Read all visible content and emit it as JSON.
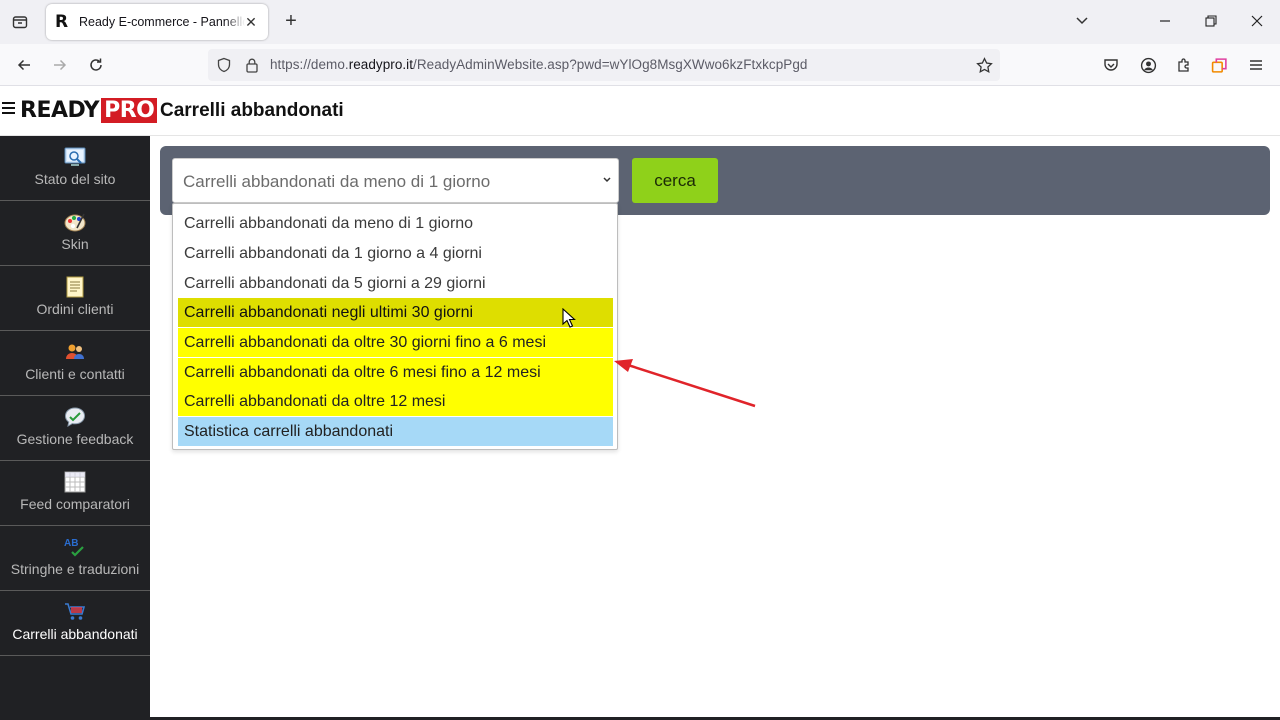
{
  "browser": {
    "tab_title": "Ready E-commerce - Pannello di controllo",
    "favicon_letter": "R",
    "url_prefix": "https://demo.",
    "url_domain": "readypro.it",
    "url_path": "/ReadyAdminWebsite.asp?pwd=wYlOg8MsgXWwo6kzFtxkcpPgd"
  },
  "header": {
    "logo_ready": "READY",
    "logo_pro": "PRO",
    "page_title": "Carrelli abbandonati"
  },
  "sidebar": {
    "items": [
      {
        "label": "Stato del sito",
        "icon": "monitor-icon"
      },
      {
        "label": "Skin",
        "icon": "palette-icon"
      },
      {
        "label": "Ordini clienti",
        "icon": "notepad-icon"
      },
      {
        "label": "Clienti e contatti",
        "icon": "users-icon"
      },
      {
        "label": "Gestione feedback",
        "icon": "feedback-bubble-icon"
      },
      {
        "label": "Feed comparatori",
        "icon": "grid-icon"
      },
      {
        "label": "Stringhe e traduzioni",
        "icon": "spellcheck-icon"
      },
      {
        "label": "Carrelli abbandonati",
        "icon": "cart-icon"
      }
    ],
    "active_index": 7
  },
  "search": {
    "selected_value": "Carrelli abbandonati da meno di 1 giorno",
    "button_label": "cerca",
    "options": [
      "Carrelli abbandonati da meno di 1 giorno",
      "Carrelli abbandonati da 1 giorno a 4 giorni",
      "Carrelli abbandonati da 5 giorni a 29 giorni",
      "Carrelli abbandonati negli ultimi 30 giorni",
      "Carrelli abbandonati da oltre 30 giorni fino a 6 mesi",
      "Carrelli abbandonati da oltre 6 mesi fino a 12 mesi",
      "Carrelli abbandonati da oltre 12 mesi",
      "Statistica carrelli abbandonati"
    ]
  },
  "colors": {
    "highlight_yellow": "#ffff00",
    "hover_yellow": "#dede00",
    "stats_blue": "#a6d9f7",
    "search_button": "#8fd11a",
    "sidebar_bg": "#202124",
    "panel_bg": "#5c6372",
    "annotation_arrow": "#e0242a"
  }
}
